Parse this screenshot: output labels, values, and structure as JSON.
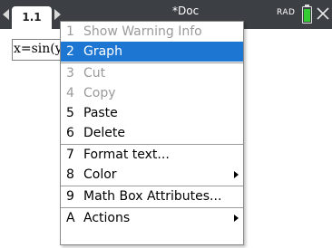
{
  "header": {
    "tab_label": "1.1",
    "doc_title": "*Doc",
    "angle_mode": "RAD",
    "battery_level": 0.9
  },
  "document": {
    "math_expression": "x=sin(y)"
  },
  "context_menu": {
    "items": [
      {
        "key": "1",
        "label": "Show Warning Info",
        "enabled": false
      },
      {
        "key": "2",
        "label": "Graph",
        "enabled": true,
        "selected": true
      },
      {
        "key": "3",
        "label": "Cut",
        "enabled": false
      },
      {
        "key": "4",
        "label": "Copy",
        "enabled": false
      },
      {
        "key": "5",
        "label": "Paste",
        "enabled": true
      },
      {
        "key": "6",
        "label": "Delete",
        "enabled": true
      },
      {
        "key": "7",
        "label": "Format text...",
        "enabled": true
      },
      {
        "key": "8",
        "label": "Color",
        "enabled": true,
        "submenu": true
      },
      {
        "key": "9",
        "label": "Math Box Attributes...",
        "enabled": true
      },
      {
        "key": "A",
        "label": "Actions",
        "enabled": true,
        "submenu": true
      }
    ]
  },
  "colors": {
    "topbar": "#3c4044",
    "selection": "#1d76d2",
    "battery": "#33cc33",
    "disabled_text": "#9a9a9a"
  }
}
